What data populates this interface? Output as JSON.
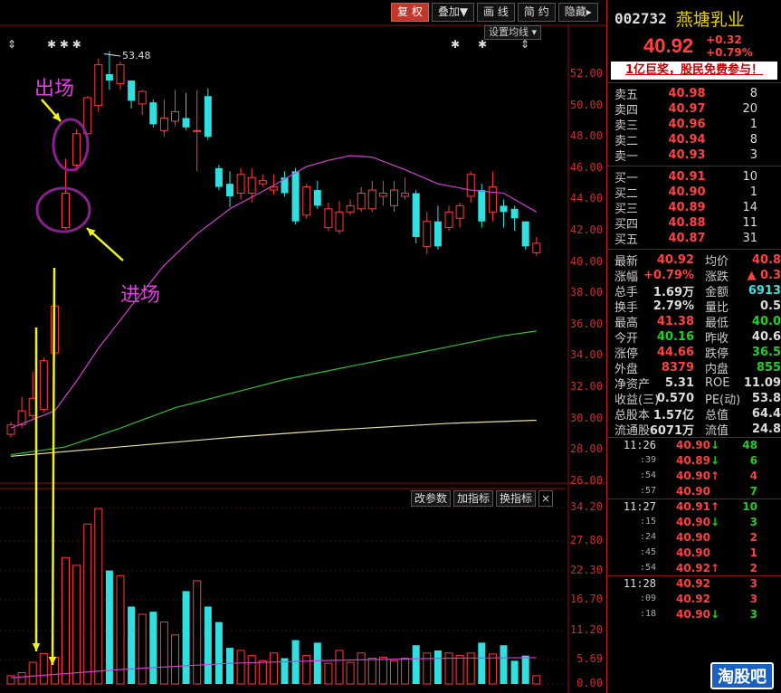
{
  "toolbar": {
    "items": [
      "复 权",
      "叠加▼",
      "画 线",
      "简 约",
      "隐藏▸"
    ]
  },
  "ma_settings_label": "设置均线 ▾",
  "indicator_buttons": [
    "改参数",
    "加指标",
    "换指标"
  ],
  "close_glyph": "×",
  "annotations": {
    "exit": "出场",
    "enter": "进场"
  },
  "peak_label": "53.48",
  "price_axis": [
    "52.00",
    "50.00",
    "48.00",
    "46.00",
    "44.00",
    "42.00",
    "40.00",
    "38.00",
    "36.00",
    "34.00",
    "32.00",
    "30.00",
    "28.00",
    "26.00"
  ],
  "volume_axis": [
    "34.20",
    "27.80",
    "22.30",
    "16.70",
    "11.20",
    "5.69",
    "0.00"
  ],
  "stock": {
    "code": "002732",
    "name": "燕塘乳业",
    "price": "40.92",
    "change": "+0.32",
    "change_pct": "+0.79%"
  },
  "banner": "1亿巨奖，股民免费参与！",
  "asks": [
    {
      "label": "卖五",
      "price": "40.98",
      "vol": "8"
    },
    {
      "label": "卖四",
      "price": "40.97",
      "vol": "20"
    },
    {
      "label": "卖三",
      "price": "40.96",
      "vol": "1"
    },
    {
      "label": "卖二",
      "price": "40.94",
      "vol": "8"
    },
    {
      "label": "卖一",
      "price": "40.93",
      "vol": "3"
    }
  ],
  "bids": [
    {
      "label": "买一",
      "price": "40.91",
      "vol": "10"
    },
    {
      "label": "买二",
      "price": "40.90",
      "vol": "1"
    },
    {
      "label": "买三",
      "price": "40.89",
      "vol": "14"
    },
    {
      "label": "买四",
      "price": "40.88",
      "vol": "11"
    },
    {
      "label": "买五",
      "price": "40.87",
      "vol": "31"
    }
  ],
  "quote": [
    {
      "k": "最新",
      "v": "40.92",
      "vc": "red",
      "k2": "均价",
      "v2": "40.8",
      "v2c": "red"
    },
    {
      "k": "涨幅",
      "v": "+0.79%",
      "vc": "red",
      "k2": "涨跌",
      "v2": "▲ 0.3",
      "v2c": "red"
    },
    {
      "k": "总手",
      "v": "1.69万",
      "vc": "white",
      "k2": "金额",
      "v2": "6913",
      "v2c": "cyan"
    },
    {
      "k": "换手",
      "v": "2.79%",
      "vc": "white",
      "k2": "量比",
      "v2": "0.5",
      "v2c": "white"
    },
    {
      "k": "最高",
      "v": "41.38",
      "vc": "red",
      "k2": "最低",
      "v2": "40.0",
      "v2c": "green"
    },
    {
      "k": "今开",
      "v": "40.16",
      "vc": "green",
      "k2": "昨收",
      "v2": "40.6",
      "v2c": "white"
    },
    {
      "k": "涨停",
      "v": "44.66",
      "vc": "red",
      "k2": "跌停",
      "v2": "36.5",
      "v2c": "green"
    },
    {
      "k": "外盘",
      "v": "8379",
      "vc": "red",
      "k2": "内盘",
      "v2": "855",
      "v2c": "green"
    },
    {
      "k": "净资产",
      "v": "5.31",
      "vc": "white",
      "k2": "ROE",
      "v2": "11.09",
      "v2c": "white"
    },
    {
      "k": "收益(三)",
      "v": "0.570",
      "vc": "white",
      "k2": "PE(动)",
      "v2": "53.8",
      "v2c": "white"
    },
    {
      "k": "总股本",
      "v": "1.57亿",
      "vc": "white",
      "k2": "总值",
      "v2": "64.4",
      "v2c": "white"
    },
    {
      "k": "流通股",
      "v": "6071万",
      "vc": "white",
      "k2": "流值",
      "v2": "24.8",
      "v2c": "white"
    }
  ],
  "ticks": [
    {
      "t": "11:26",
      "p": "40.90",
      "pc": "red",
      "d": "↓",
      "dc": "green",
      "v": "48",
      "vc": "green",
      "first": true
    },
    {
      "t": ":39",
      "p": "40.89",
      "pc": "red",
      "d": "↓",
      "dc": "green",
      "v": "6",
      "vc": "green"
    },
    {
      "t": ":54",
      "p": "40.90",
      "pc": "red",
      "d": "↑",
      "dc": "red",
      "v": "4",
      "vc": "red"
    },
    {
      "t": ":57",
      "p": "40.90",
      "pc": "red",
      "d": "",
      "dc": "white",
      "v": "7",
      "vc": "green"
    },
    {
      "t": "11:27",
      "p": "40.91",
      "pc": "red",
      "d": "↑",
      "dc": "red",
      "v": "10",
      "vc": "green",
      "first": true
    },
    {
      "t": ":15",
      "p": "40.90",
      "pc": "red",
      "d": "↓",
      "dc": "green",
      "v": "3",
      "vc": "green"
    },
    {
      "t": ":24",
      "p": "40.90",
      "pc": "red",
      "d": "",
      "dc": "white",
      "v": "2",
      "vc": "red"
    },
    {
      "t": ":45",
      "p": "40.90",
      "pc": "red",
      "d": "",
      "dc": "white",
      "v": "1",
      "vc": "red"
    },
    {
      "t": ":54",
      "p": "40.92",
      "pc": "red",
      "d": "↑",
      "dc": "red",
      "v": "2",
      "vc": "red"
    },
    {
      "t": "11:28",
      "p": "40.92",
      "pc": "red",
      "d": "",
      "dc": "white",
      "v": "3",
      "vc": "red",
      "first": true
    },
    {
      "t": ":09",
      "p": "40.92",
      "pc": "red",
      "d": "",
      "dc": "white",
      "v": "3",
      "vc": "red"
    },
    {
      "t": ":18",
      "p": "40.90",
      "pc": "red",
      "d": "↓",
      "dc": "green",
      "v": "3",
      "vc": "green"
    }
  ],
  "watermark": "淘股吧",
  "chart_data": {
    "type": "candlestick",
    "y_range": [
      26,
      53.48
    ],
    "volume_range": [
      0,
      34.2
    ],
    "candles": [
      {
        "o": 29.0,
        "c": 29.6,
        "h": 29.8,
        "l": 28.8,
        "v": 1.6,
        "up": true
      },
      {
        "o": 29.6,
        "c": 30.5,
        "h": 31.4,
        "l": 29.4,
        "v": 2.2,
        "up": true
      },
      {
        "o": 30.2,
        "c": 31.3,
        "h": 33.0,
        "l": 30.0,
        "v": 4.2,
        "up": true
      },
      {
        "o": 30.6,
        "c": 33.7,
        "h": 33.9,
        "l": 30.4,
        "v": 5.9,
        "up": true
      },
      {
        "o": 34.2,
        "c": 37.2,
        "h": 37.3,
        "l": 34.0,
        "v": 5.2,
        "up": true
      },
      {
        "o": 44.4,
        "c": 42.2,
        "h": 46.6,
        "l": 42.1,
        "v": 24.5,
        "up": true
      },
      {
        "o": 46.2,
        "c": 48.2,
        "h": 48.5,
        "l": 45.8,
        "v": 23.0,
        "up": true
      },
      {
        "o": 48.2,
        "c": 50.5,
        "h": 50.6,
        "l": 47.8,
        "v": 31.0,
        "up": true
      },
      {
        "o": 50.0,
        "c": 52.6,
        "h": 53.0,
        "l": 49.6,
        "v": 34.0,
        "up": true
      },
      {
        "o": 52.0,
        "c": 51.6,
        "h": 53.48,
        "l": 51.0,
        "v": 22.0,
        "up": false
      },
      {
        "o": 51.4,
        "c": 52.6,
        "h": 52.8,
        "l": 51.0,
        "v": 21.0,
        "up": true
      },
      {
        "o": 51.6,
        "c": 50.3,
        "h": 51.6,
        "l": 49.8,
        "v": 15.0,
        "up": false
      },
      {
        "o": 50.1,
        "c": 50.9,
        "h": 51.0,
        "l": 49.4,
        "v": 13.5,
        "up": true
      },
      {
        "o": 50.2,
        "c": 48.8,
        "h": 50.4,
        "l": 48.6,
        "v": 14.0,
        "up": false
      },
      {
        "o": 48.4,
        "c": 49.2,
        "h": 50.4,
        "l": 48.0,
        "v": 12.0,
        "up": true
      },
      {
        "o": 49.0,
        "c": 49.6,
        "h": 51.0,
        "l": 48.7,
        "v": 9.5,
        "up": true
      },
      {
        "o": 49.2,
        "c": 48.6,
        "h": 50.8,
        "l": 48.4,
        "v": 18.0,
        "up": false
      },
      {
        "o": 48.4,
        "c": 48.4,
        "h": 51.0,
        "l": 45.8,
        "v": 20.0,
        "up": true
      },
      {
        "o": 48.0,
        "c": 50.6,
        "h": 51.1,
        "l": 47.8,
        "v": 15.0,
        "up": false
      },
      {
        "o": 46.0,
        "c": 44.8,
        "h": 46.2,
        "l": 44.6,
        "v": 12.0,
        "up": false
      },
      {
        "o": 45.0,
        "c": 44.2,
        "h": 45.8,
        "l": 43.5,
        "v": 7.0,
        "up": false
      },
      {
        "o": 44.4,
        "c": 45.6,
        "h": 46.0,
        "l": 44.0,
        "v": 6.5,
        "up": true
      },
      {
        "o": 44.4,
        "c": 45.4,
        "h": 46.0,
        "l": 43.8,
        "v": 5.5,
        "up": true
      },
      {
        "o": 45.0,
        "c": 45.2,
        "h": 45.6,
        "l": 44.8,
        "v": 4.5,
        "up": true
      },
      {
        "o": 44.6,
        "c": 44.8,
        "h": 45.6,
        "l": 44.3,
        "v": 6.0,
        "up": true
      },
      {
        "o": 45.4,
        "c": 44.4,
        "h": 45.8,
        "l": 44.2,
        "v": 5.0,
        "up": false
      },
      {
        "o": 45.8,
        "c": 42.6,
        "h": 46.0,
        "l": 42.4,
        "v": 8.5,
        "up": false
      },
      {
        "o": 43.0,
        "c": 44.8,
        "h": 45.0,
        "l": 42.8,
        "v": 5.5,
        "up": true
      },
      {
        "o": 44.6,
        "c": 43.6,
        "h": 45.2,
        "l": 43.4,
        "v": 8.0,
        "up": false
      },
      {
        "o": 42.2,
        "c": 43.4,
        "h": 43.8,
        "l": 42.0,
        "v": 4.0,
        "up": true
      },
      {
        "o": 42.0,
        "c": 43.2,
        "h": 43.9,
        "l": 41.8,
        "v": 6.5,
        "up": true
      },
      {
        "o": 43.2,
        "c": 43.6,
        "h": 44.0,
        "l": 43.0,
        "v": 4.2,
        "up": true
      },
      {
        "o": 43.4,
        "c": 44.4,
        "h": 44.8,
        "l": 43.2,
        "v": 6.0,
        "up": true
      },
      {
        "o": 43.4,
        "c": 44.6,
        "h": 45.2,
        "l": 43.2,
        "v": 5.0,
        "up": true
      },
      {
        "o": 44.2,
        "c": 44.4,
        "h": 45.2,
        "l": 43.6,
        "v": 5.2,
        "up": true
      },
      {
        "o": 43.6,
        "c": 44.6,
        "h": 45.2,
        "l": 43.2,
        "v": 4.5,
        "up": true
      },
      {
        "o": 44.4,
        "c": 44.2,
        "h": 45.4,
        "l": 44.0,
        "v": 5.0,
        "up": true
      },
      {
        "o": 44.4,
        "c": 41.6,
        "h": 44.6,
        "l": 41.2,
        "v": 7.5,
        "up": false
      },
      {
        "o": 41.0,
        "c": 42.6,
        "h": 43.2,
        "l": 40.5,
        "v": 6.0,
        "up": true
      },
      {
        "o": 42.6,
        "c": 41.0,
        "h": 43.6,
        "l": 40.8,
        "v": 6.5,
        "up": false
      },
      {
        "o": 42.2,
        "c": 43.2,
        "h": 43.6,
        "l": 42.0,
        "v": 6.0,
        "up": true
      },
      {
        "o": 42.8,
        "c": 43.6,
        "h": 43.8,
        "l": 42.2,
        "v": 5.5,
        "up": true
      },
      {
        "o": 44.2,
        "c": 45.6,
        "h": 45.8,
        "l": 43.8,
        "v": 6.0,
        "up": true
      },
      {
        "o": 44.6,
        "c": 42.6,
        "h": 45.0,
        "l": 42.2,
        "v": 8.0,
        "up": false
      },
      {
        "o": 43.2,
        "c": 44.8,
        "h": 45.8,
        "l": 42.6,
        "v": 5.8,
        "up": true
      },
      {
        "o": 43.6,
        "c": 43.2,
        "h": 44.0,
        "l": 42.2,
        "v": 7.5,
        "up": false
      },
      {
        "o": 43.4,
        "c": 42.8,
        "h": 43.6,
        "l": 42.0,
        "v": 4.5,
        "up": false
      },
      {
        "o": 42.6,
        "c": 41.0,
        "h": 42.6,
        "l": 40.8,
        "v": 5.5,
        "up": false
      },
      {
        "o": 40.6,
        "c": 41.2,
        "h": 41.6,
        "l": 40.4,
        "v": 1.6,
        "up": true
      }
    ],
    "ma_series": [
      {
        "name": "",
        "color": "#d040d0",
        "points": [
          [
            0,
            29.4
          ],
          [
            4,
            30.5
          ],
          [
            6,
            32.4
          ],
          [
            8,
            34.5
          ],
          [
            11,
            37.2
          ],
          [
            14,
            39.8
          ],
          [
            17,
            41.8
          ],
          [
            20,
            43.4
          ],
          [
            24,
            44.9
          ],
          [
            27,
            46.1
          ],
          [
            29,
            46.5
          ],
          [
            31,
            46.8
          ],
          [
            33,
            46.7
          ],
          [
            36,
            45.9
          ],
          [
            39,
            45.0
          ],
          [
            42,
            44.6
          ],
          [
            45,
            44.4
          ],
          [
            48,
            43.2
          ]
        ]
      },
      {
        "name": "",
        "color": "#30c030",
        "points": [
          [
            0,
            27.7
          ],
          [
            5,
            28.2
          ],
          [
            10,
            29.4
          ],
          [
            15,
            30.7
          ],
          [
            20,
            31.6
          ],
          [
            25,
            32.5
          ],
          [
            30,
            33.2
          ],
          [
            35,
            33.9
          ],
          [
            40,
            34.6
          ],
          [
            45,
            35.3
          ],
          [
            48,
            35.6
          ]
        ]
      },
      {
        "name": "",
        "color": "#e8e0a0",
        "points": [
          [
            0,
            27.6
          ],
          [
            10,
            28.2
          ],
          [
            20,
            28.8
          ],
          [
            30,
            29.3
          ],
          [
            40,
            29.7
          ],
          [
            48,
            29.9
          ]
        ]
      }
    ],
    "volume_ma": [
      [
        0,
        1.2
      ],
      [
        10,
        2.8
      ],
      [
        20,
        4.0
      ],
      [
        30,
        4.6
      ],
      [
        40,
        5.0
      ],
      [
        48,
        5.1
      ]
    ]
  }
}
